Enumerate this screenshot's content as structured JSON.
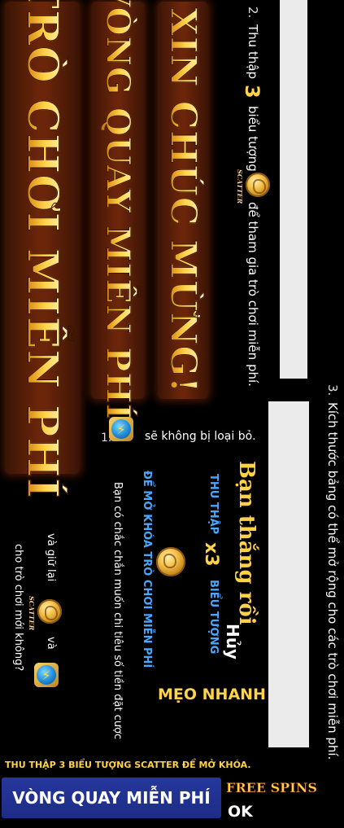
{
  "banners": {
    "congrats": "XIN CHÚC MỪNG!",
    "free_spin_wheel": "VÒNG QUAY MIỄN PHÍ",
    "free_game": "TRÒ CHƠI MIỄN PHÍ"
  },
  "tips": {
    "tip2_number": "2.",
    "tip2_text_a": "Thu thập",
    "tip2_count": "3",
    "tip2_text_b": "biểu tượng",
    "tip2_text_c": "để tham gia trò chơi miễn phí.",
    "tip3_number": "3.",
    "tip3_text": "Kích thước bảng có thể mở rộng cho các trò chơi miễn phí.",
    "tip1_number": "1.",
    "tip1_text": "sẽ không bị loại bỏ."
  },
  "scatter_label": "SCATTER",
  "win_panel": {
    "title": "Bạn thắng rồi",
    "collect": "THU THẬP",
    "multiplier": "x3",
    "symbols": "BIỂU TƯỢNG",
    "unlock": "ĐỂ MỞ KHÓA TRÒ CHƠI MIỄN PHÍ"
  },
  "confirm": {
    "question": "Bạn có chắc chắn muốn chi tiêu số tiền đặt cược",
    "keep": "và giữ lại",
    "and": "và",
    "for_new": "cho trò chơi mới không?",
    "cancel": "Hủy",
    "quick_tip": "MẸO NHANH"
  },
  "footer": {
    "unlock_hint": "THU THẬP 3 BIỂU TƯỢNG SCATTER ĐỂ MỞ KHÓA.",
    "wheel_button": "VÒNG QUAY MIỄN PHÍ",
    "free_spins": "FREE SPINS",
    "ok": "OK"
  },
  "colors": {
    "gold": "#ffd24a",
    "blue_label": "#4aa7ff",
    "footer_blue": "#1d2c86"
  }
}
